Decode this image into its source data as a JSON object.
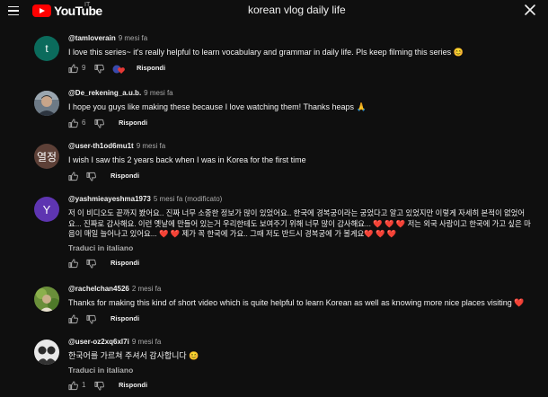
{
  "app": {
    "logo_text": "YouTube",
    "country_code": "IT"
  },
  "search": {
    "value": "korean vlog daily life"
  },
  "comments": [
    {
      "author": "@tamloverain",
      "time": "9 mesi fa",
      "text": "I love this series~ it's really helpful to learn vocabulary and grammar in daily life. Pls keep filming this series 😊",
      "likes": "9",
      "reply_label": "Rispondi",
      "avatar_letter": "t",
      "avatar_color": "#0b6b5c"
    },
    {
      "author": "@De_rekening_a.u.b.",
      "time": "9 mesi fa",
      "text": "I hope you guys like making these because I love watching them! Thanks heaps 🙏",
      "likes": "6",
      "reply_label": "Rispondi"
    },
    {
      "author": "@user-th1od6mu1t",
      "time": "9 mesi fa",
      "text": "I wish I saw this 2 years back when I was in Korea for the first time",
      "reply_label": "Rispondi",
      "avatar_letter": "열정",
      "avatar_color": "#5d4037"
    },
    {
      "author": "@yashmieayeshma1973",
      "time": "5 mesi fa (modificato)",
      "text": "저 이 비디오도 끝까지 봤어요.. 진짜 너무 소중한 정보가 많이 있었어요.. 한국에 경복궁이라는 궁었다고 알고 있었지만 이렇게 자세히 본적이 없었어요... 진짜로 감사해요. 이런 옛날에 만들어 있는거 우리한테도 보여주기 위해 너무 많이 감사해요... ❤️ ❤️ ❤️  저는 외국 사람이고 한국에 가고 싶은 마음이 매일 늘어나고 있어요... ❤️ ❤️  제가 꼭 한국에 가요.. 그때 저도 반드시 경복궁에 가 볼게요❤️ ❤️ ❤️",
      "translate_label": "Traduci in italiano",
      "reply_label": "Rispondi",
      "avatar_letter": "Y",
      "avatar_color": "#5e35b1"
    },
    {
      "author": "@rachelchan4526",
      "time": "2 mesi fa",
      "text": "Thanks for making this kind of short video which is quite helpful to learn Korean as well as knowing more nice places visiting ❤️",
      "reply_label": "Rispondi"
    },
    {
      "author": "@user-oz2xq6xl7i",
      "time": "9 mesi fa",
      "text": "한국어를 가르쳐 주셔서 감사합니다 😊",
      "translate_label": "Traduci in italiano",
      "likes": "1",
      "reply_label": "Rispondi"
    }
  ],
  "colors": {
    "background": "#0f0f0f",
    "text_primary": "#f1f1f1",
    "text_secondary": "#aaaaaa",
    "brand_red": "#ff0000",
    "heart_red": "#e53935"
  },
  "icons": [
    "menu-icon",
    "youtube-logo",
    "close-icon",
    "like-icon",
    "dislike-icon",
    "creator-heart-icon"
  ]
}
